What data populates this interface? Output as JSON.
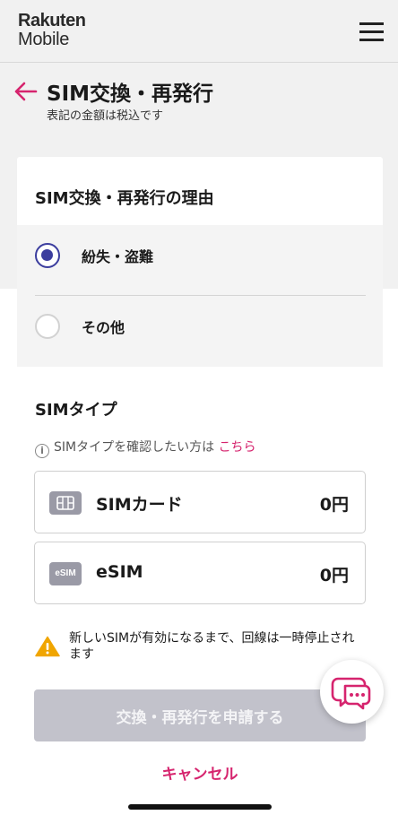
{
  "header": {
    "logo_line1": "Rakuten",
    "logo_line2": "Mobile",
    "menu_icon": "hamburger-menu-icon"
  },
  "page": {
    "back_icon": "arrow-left-icon",
    "title": "SIM交換・再発行",
    "subtitle": "表記の金額は税込です"
  },
  "reason": {
    "title": "SIM交換・再発行の理由",
    "options": [
      {
        "label": "紛失・盗難",
        "selected": true
      },
      {
        "label": "その他",
        "selected": false
      }
    ]
  },
  "sim_type": {
    "title": "SIMタイプ",
    "info_prefix": "SIMタイプを確認したい方は",
    "info_link": "こちら",
    "options": [
      {
        "name": "SIMカード",
        "price": "0円",
        "icon": "sim-card-icon"
      },
      {
        "name": "eSIM",
        "price": "0円",
        "icon": "esim-icon",
        "icon_text": "eSIM"
      }
    ]
  },
  "warning": {
    "icon": "warning-triangle-icon",
    "text": "新しいSIMが有効になるまで、回線は一時停止されます"
  },
  "actions": {
    "submit_label": "交換・再発行を申請する",
    "cancel_label": "キャンセル"
  },
  "chat": {
    "icon": "chat-bubble-icon"
  },
  "colors": {
    "accent": "#d6246e",
    "radio_selected": "#3b3d9e",
    "button_disabled": "#c2c2cb",
    "warning": "#f0a500"
  }
}
